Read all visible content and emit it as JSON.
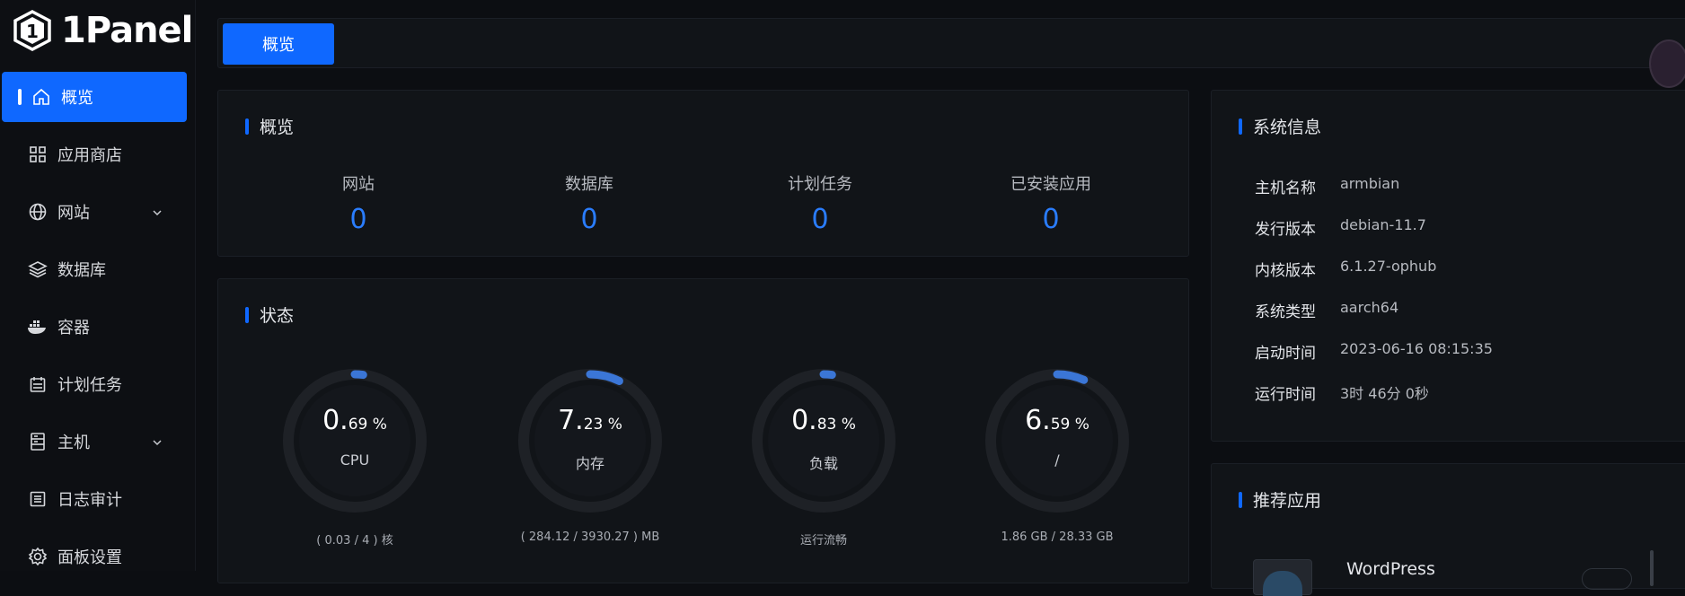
{
  "app": {
    "logo_text": "1Panel"
  },
  "sidebar": {
    "items": [
      {
        "label": "概览",
        "icon": "home-icon",
        "active": true
      },
      {
        "label": "应用商店",
        "icon": "grid-icon"
      },
      {
        "label": "网站",
        "icon": "globe-icon",
        "has_children": true
      },
      {
        "label": "数据库",
        "icon": "layers-icon"
      },
      {
        "label": "容器",
        "icon": "docker-icon"
      },
      {
        "label": "计划任务",
        "icon": "calendar-icon"
      },
      {
        "label": "主机",
        "icon": "server-icon",
        "has_children": true
      },
      {
        "label": "日志审计",
        "icon": "list-icon"
      },
      {
        "label": "面板设置",
        "icon": "gear-icon"
      }
    ]
  },
  "tabs": {
    "active_label": "概览"
  },
  "overview": {
    "title": "概览",
    "items": [
      {
        "label": "网站",
        "value": "0"
      },
      {
        "label": "数据库",
        "value": "0"
      },
      {
        "label": "计划任务",
        "value": "0"
      },
      {
        "label": "已安装应用",
        "value": "0"
      }
    ]
  },
  "status": {
    "title": "状态",
    "gauges": [
      {
        "int": "0.",
        "dec": "69 %",
        "percent": 0.69,
        "label": "CPU",
        "footer": "( 0.03 / 4 ) 核"
      },
      {
        "int": "7.",
        "dec": "23 %",
        "percent": 7.23,
        "label": "内存",
        "footer": "( 284.12 / 3930.27 ) MB"
      },
      {
        "int": "0.",
        "dec": "83 %",
        "percent": 0.83,
        "label": "负载",
        "footer": "运行流畅"
      },
      {
        "int": "6.",
        "dec": "59 %",
        "percent": 6.59,
        "label": "/",
        "footer": "1.86 GB / 28.33 GB"
      }
    ]
  },
  "sysinfo": {
    "title": "系统信息",
    "rows": [
      {
        "key": "主机名称",
        "value": "armbian"
      },
      {
        "key": "发行版本",
        "value": "debian-11.7"
      },
      {
        "key": "内核版本",
        "value": "6.1.27-ophub"
      },
      {
        "key": "系统类型",
        "value": "aarch64"
      },
      {
        "key": "启动时间",
        "value": "2023-06-16 08:15:35"
      },
      {
        "key": "运行时间",
        "value": "3时 46分 0秒"
      }
    ]
  },
  "recommend": {
    "title": "推荐应用",
    "apps": [
      {
        "name": "WordPress"
      }
    ]
  },
  "colors": {
    "accent": "#0f68ff",
    "gauge_track": "#1e2126",
    "gauge_fill": "#3b76d6"
  }
}
